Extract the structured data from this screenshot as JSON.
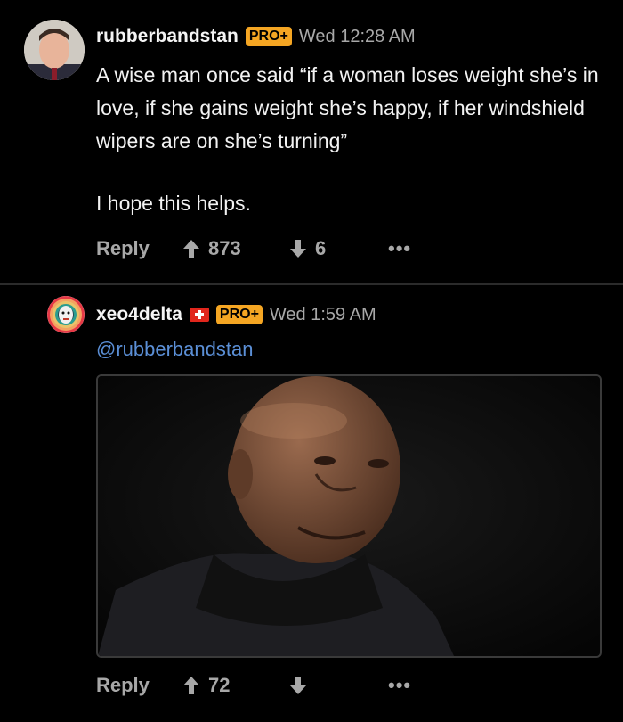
{
  "comments": [
    {
      "username": "rubberbandstan",
      "badge": "PRO+",
      "time": "Wed 12:28 AM",
      "text_p1": "A wise man once said “if a woman loses weight she’s in love, if she gains weight she’s happy, if her windshield wipers are on she’s turning”",
      "text_p2": "I hope this helps.",
      "reply_label": "Reply",
      "upvotes": "873",
      "downvotes": "6",
      "more": "•••"
    },
    {
      "username": "xeo4delta",
      "badge": "PRO+",
      "time": "Wed 1:59 AM",
      "mention": "@rubberbandstan",
      "reply_label": "Reply",
      "upvotes": "72",
      "downvotes": "",
      "more": "•••"
    }
  ],
  "colors": {
    "background": "#000000",
    "badge": "#f5a623",
    "link": "#5b8fd6",
    "muted": "#a8a8a8"
  }
}
